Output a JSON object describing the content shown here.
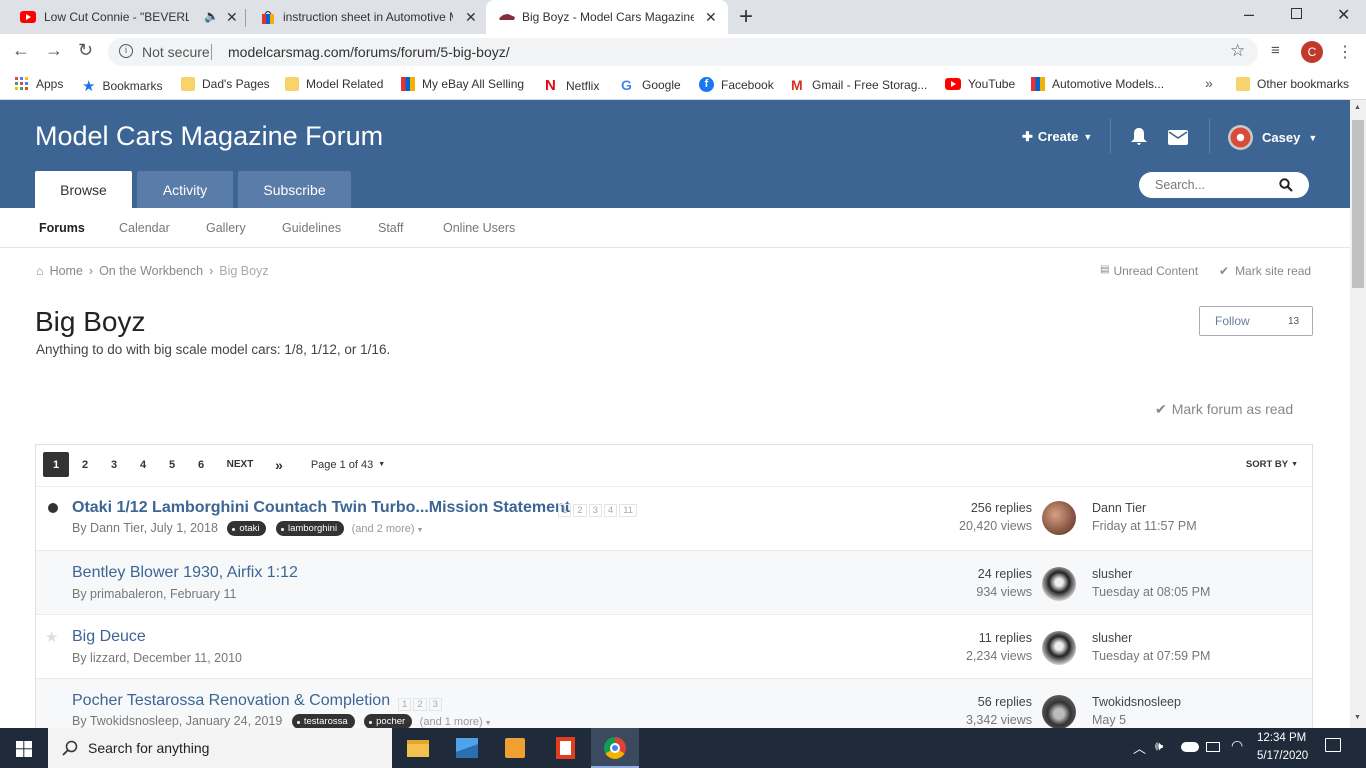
{
  "browser": {
    "tabs": [
      {
        "title": "Low Cut Connie - \"BEVERLY\"",
        "favicon": "youtube-icon",
        "audio": true
      },
      {
        "title": "instruction sheet in Automotive M",
        "favicon": "ebay-icon"
      },
      {
        "title": "Big Boyz - Model Cars Magazine",
        "favicon": "car-icon",
        "active": true
      }
    ],
    "new_tab": "+",
    "address": {
      "security": "Not secure",
      "url": "modelcarsmag.com/forums/forum/5-big-boyz/"
    },
    "profile_letter": "C",
    "bookmarks": [
      {
        "label": "Apps",
        "icon": "apps-grid-icon"
      },
      {
        "label": "Bookmarks",
        "icon": "star-icon"
      },
      {
        "label": "Dad's Pages",
        "icon": "folder-icon"
      },
      {
        "label": "Model Related",
        "icon": "folder-icon"
      },
      {
        "label": "My eBay All Selling",
        "icon": "ebay-icon"
      },
      {
        "label": "Netflix",
        "icon": "netflix-icon"
      },
      {
        "label": "Google",
        "icon": "google-icon"
      },
      {
        "label": "Facebook",
        "icon": "facebook-icon"
      },
      {
        "label": "Gmail - Free Storag...",
        "icon": "gmail-icon"
      },
      {
        "label": "YouTube",
        "icon": "youtube-icon"
      },
      {
        "label": "Automotive Models...",
        "icon": "ebay-icon"
      }
    ],
    "more_bookmarks": "»",
    "other_bookmarks": "Other bookmarks"
  },
  "site": {
    "title": "Model Cars Magazine Forum",
    "create_label": "Create",
    "user_name": "Casey",
    "nav_tabs": [
      "Browse",
      "Activity",
      "Subscribe"
    ],
    "search_placeholder": "Search...",
    "subnav": [
      "Forums",
      "Calendar",
      "Gallery",
      "Guidelines",
      "Staff",
      "Online Users"
    ],
    "breadcrumb": [
      "Home",
      "On the Workbench",
      "Big Boyz"
    ],
    "unread_content": "Unread Content",
    "mark_site_read": "Mark site read"
  },
  "forum": {
    "title": "Big Boyz",
    "description": "Anything to do with big scale model cars: 1/8, 1/12, or 1/16.",
    "follow_label": "Follow",
    "follow_count": "13",
    "mark_forum_read": "Mark forum as read",
    "pagination": {
      "pages": [
        "1",
        "2",
        "3",
        "4",
        "5",
        "6"
      ],
      "next": "NEXT",
      "last": "»",
      "page_of": "Page 1 of 43",
      "sort": "SORT BY"
    },
    "topics": [
      {
        "title": "Otaki 1/12 Lamborghini Countach Twin Turbo...Mission Statement",
        "meta": "By Dann Tier, July 1, 2018",
        "tags": [
          "otaki",
          "lamborghini"
        ],
        "more_tags": "(and 2 more)",
        "pages": [
          "1",
          "2",
          "3",
          "4",
          "11"
        ],
        "replies": "256 replies",
        "views": "20,420 views",
        "last_poster": "Dann Tier",
        "last_date": "Friday at 11:57 PM",
        "unread": true
      },
      {
        "title": "Bentley Blower 1930, Airfix 1:12",
        "meta": "By primabaleron, February 11",
        "tags": [],
        "more_tags": "",
        "pages": [],
        "replies": "24 replies",
        "views": "934 views",
        "last_poster": "slusher",
        "last_date": "Tuesday at 08:05 PM"
      },
      {
        "title": "Big Deuce",
        "meta": "By lizzard, December 11, 2010",
        "tags": [],
        "more_tags": "",
        "pages": [],
        "replies": "11 replies",
        "views": "2,234 views",
        "last_poster": "slusher",
        "last_date": "Tuesday at 07:59 PM"
      },
      {
        "title": "Pocher Testarossa Renovation & Completion",
        "meta": "By Twokidsnosleep, January 24, 2019",
        "tags": [
          "testarossa",
          "pocher"
        ],
        "more_tags": "(and 1 more)",
        "pages": [
          "1",
          "2",
          "3"
        ],
        "replies": "56 replies",
        "views": "3,342 views",
        "last_poster": "Twokidsnosleep",
        "last_date": "May 5"
      }
    ]
  },
  "taskbar": {
    "search": "Search for anything",
    "time": "12:34 PM",
    "date": "5/17/2020"
  }
}
